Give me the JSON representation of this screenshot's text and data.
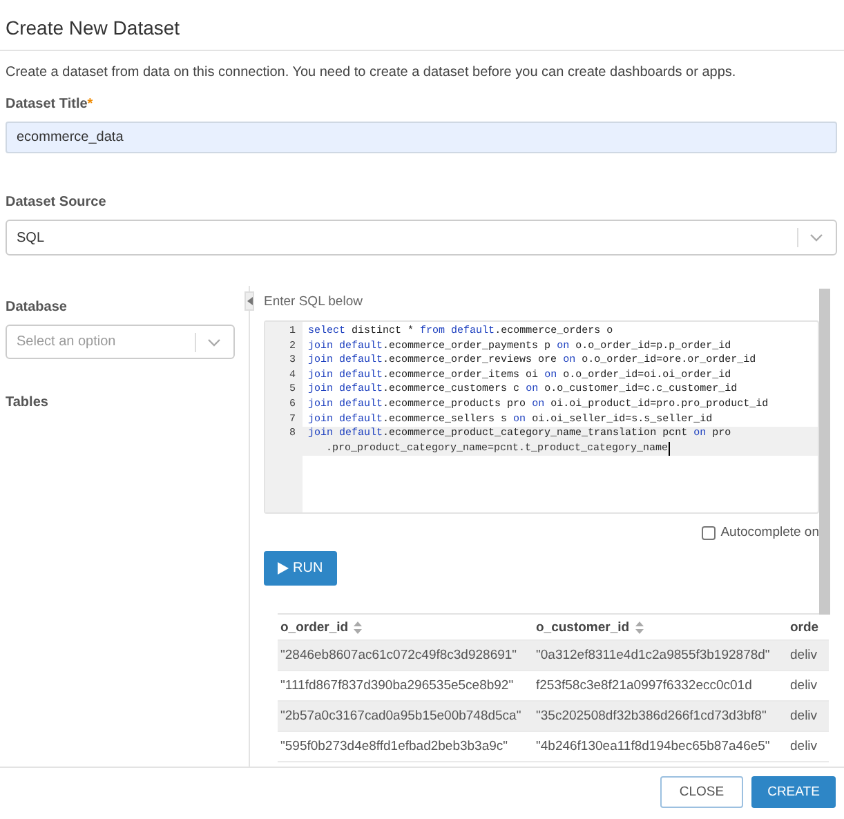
{
  "dialog": {
    "title": "Create New Dataset",
    "description": "Create a dataset from data on this connection. You need to create a dataset before you can create dashboards or apps."
  },
  "title_field": {
    "label": "Dataset Title",
    "required_mark": "*",
    "value": "ecommerce_data"
  },
  "source_field": {
    "label": "Dataset Source",
    "value": "SQL"
  },
  "database_field": {
    "label": "Database",
    "placeholder": "Select an option"
  },
  "tables_label": "Tables",
  "sql_editor": {
    "label": "Enter SQL below",
    "lines": [
      {
        "number": "1",
        "active": false,
        "tokens": [
          {
            "text": "select",
            "kind": "keyword"
          },
          {
            "text": " distinct * ",
            "kind": "plain"
          },
          {
            "text": "from ",
            "kind": "keyword"
          },
          {
            "text": "default",
            "kind": "keyword"
          },
          {
            "text": ".ecommerce_orders o",
            "kind": "plain"
          }
        ]
      },
      {
        "number": "2",
        "active": false,
        "tokens": [
          {
            "text": "join ",
            "kind": "keyword"
          },
          {
            "text": "default",
            "kind": "keyword"
          },
          {
            "text": ".ecommerce_order_payments p ",
            "kind": "plain"
          },
          {
            "text": "on",
            "kind": "keyword"
          },
          {
            "text": " o.o_order_id=p.p_order_id",
            "kind": "plain"
          }
        ]
      },
      {
        "number": "3",
        "active": false,
        "tokens": [
          {
            "text": "join ",
            "kind": "keyword"
          },
          {
            "text": "default",
            "kind": "keyword"
          },
          {
            "text": ".ecommerce_order_reviews ore ",
            "kind": "plain"
          },
          {
            "text": "on",
            "kind": "keyword"
          },
          {
            "text": " o.o_order_id=ore.or_order_id",
            "kind": "plain"
          }
        ]
      },
      {
        "number": "4",
        "active": false,
        "tokens": [
          {
            "text": "join ",
            "kind": "keyword"
          },
          {
            "text": "default",
            "kind": "keyword"
          },
          {
            "text": ".ecommerce_order_items oi ",
            "kind": "plain"
          },
          {
            "text": "on",
            "kind": "keyword"
          },
          {
            "text": " o.o_order_id=oi.oi_order_id",
            "kind": "plain"
          }
        ]
      },
      {
        "number": "5",
        "active": false,
        "tokens": [
          {
            "text": "join ",
            "kind": "keyword"
          },
          {
            "text": "default",
            "kind": "keyword"
          },
          {
            "text": ".ecommerce_customers c ",
            "kind": "plain"
          },
          {
            "text": "on",
            "kind": "keyword"
          },
          {
            "text": " o.o_customer_id=c.c_customer_id",
            "kind": "plain"
          }
        ]
      },
      {
        "number": "6",
        "active": false,
        "tokens": [
          {
            "text": "join ",
            "kind": "keyword"
          },
          {
            "text": "default",
            "kind": "keyword"
          },
          {
            "text": ".ecommerce_products pro ",
            "kind": "plain"
          },
          {
            "text": "on",
            "kind": "keyword"
          },
          {
            "text": " oi.oi_product_id=pro.pro_product_id",
            "kind": "plain"
          }
        ]
      },
      {
        "number": "7",
        "active": false,
        "tokens": [
          {
            "text": "join ",
            "kind": "keyword"
          },
          {
            "text": "default",
            "kind": "keyword"
          },
          {
            "text": ".ecommerce_sellers s ",
            "kind": "plain"
          },
          {
            "text": "on",
            "kind": "keyword"
          },
          {
            "text": " oi.oi_seller_id=s.s_seller_id",
            "kind": "plain"
          }
        ]
      },
      {
        "number": "8",
        "tokens": [
          {
            "text": "join ",
            "kind": "keyword"
          },
          {
            "text": "default",
            "kind": "keyword"
          },
          {
            "text": ".ecommerce_product_category_name_translation pcnt ",
            "kind": "plain"
          },
          {
            "text": "on",
            "kind": "keyword"
          },
          {
            "text": " pro",
            "kind": "plain"
          }
        ],
        "active": true,
        "continuation": ".pro_product_category_name=pcnt.t_product_category_name"
      }
    ]
  },
  "autocomplete": {
    "label": "Autocomplete on",
    "checked": false
  },
  "run_button": "RUN",
  "results": {
    "columns": [
      "o_order_id",
      "o_customer_id",
      "orde"
    ],
    "rows": [
      [
        "\"2846eb8607ac61c072c49f8c3d928691\"",
        "\"0a312ef8311e4d1c2a9855f3b192878d\"",
        "deliv"
      ],
      [
        "\"111fd867f837d390ba296535e5ce8b92\"",
        "f253f58c3e8f21a0997f6332ecc0c01d",
        "deliv"
      ],
      [
        "\"2b57a0c3167cad0a95b15e00b748d5ca\"",
        "\"35c202508df32b386d266f1cd73d3bf8\"",
        "deliv"
      ],
      [
        "\"595f0b273d4e8ffd1efbad2beb3b3a9c\"",
        "\"4b246f130ea11f8d194bec65b87a46e5\"",
        "deliv"
      ]
    ]
  },
  "buttons": [
    {
      "label": "CLOSE",
      "kind": "secondary"
    },
    {
      "label": "CREATE",
      "kind": "primary"
    }
  ]
}
